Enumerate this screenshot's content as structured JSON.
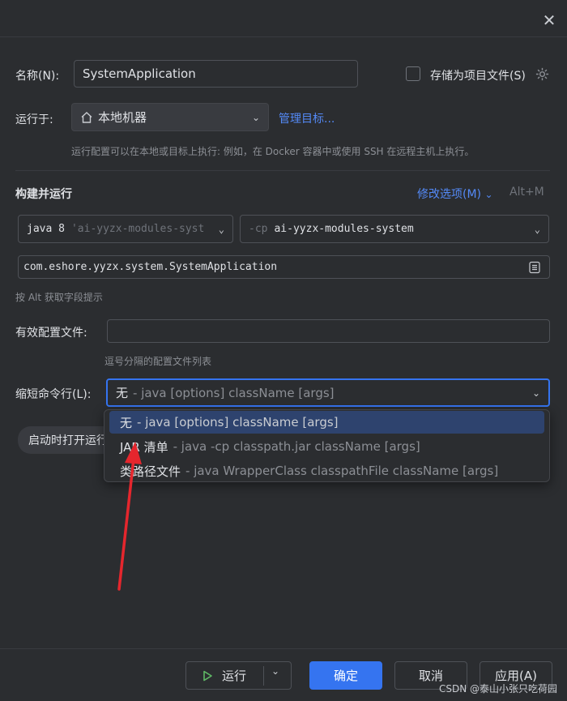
{
  "dialog": {
    "name_label": "名称(N):",
    "name_value": "SystemApplication",
    "store_as_file_label": "存储为项目文件(S)",
    "run_on_label": "运行于:",
    "run_on_value": "本地机器",
    "manage_targets_link": "管理目标...",
    "run_on_hint": "运行配置可以在本地或目标上执行: 例如，在 Docker 容器中或使用 SSH 在远程主机上执行。",
    "build_run_title": "构建并运行",
    "modify_options_link": "修改选项(M)",
    "modify_options_shortcut": "Alt+M",
    "jre_value": "java 8",
    "jre_module_hint": "'ai-yyzx-modules-syst",
    "classpath_prefix": "-cp",
    "classpath_value": "ai-yyzx-modules-system",
    "main_class_value": "com.eshore.yyzx.system.SystemApplication",
    "alt_hint": "按 Alt 获取字段提示",
    "profiles_label": "有效配置文件:",
    "profiles_value": "",
    "profiles_hint": "逗号分隔的配置文件列表",
    "shorten_label": "缩短命令行(L):",
    "shorten_selected_key": "无",
    "shorten_selected_desc": "- java [options] className [args]",
    "launch_pill_label": "启动时打开运行"
  },
  "shorten_options": [
    {
      "key": "无",
      "desc": "- java [options] className [args]"
    },
    {
      "key": "JAR 清单",
      "desc": "- java -cp classpath.jar className [args]"
    },
    {
      "key": "类路径文件",
      "desc": "- java WrapperClass classpathFile className [args]"
    }
  ],
  "footer": {
    "run_label": "运行",
    "ok_label": "确定",
    "cancel_label": "取消",
    "apply_label": "应用(A)"
  },
  "watermark": "CSDN @泰山小张只吃荷园",
  "colors": {
    "background": "#2b2d30",
    "accent": "#3574f0",
    "link": "#548af7",
    "selection": "#2e436e",
    "arrow": "#e5262d"
  },
  "icons": [
    "close-icon",
    "home-icon",
    "chevron-down-icon",
    "settings-icon",
    "document-icon",
    "play-icon",
    "red-arrow-annotation"
  ]
}
